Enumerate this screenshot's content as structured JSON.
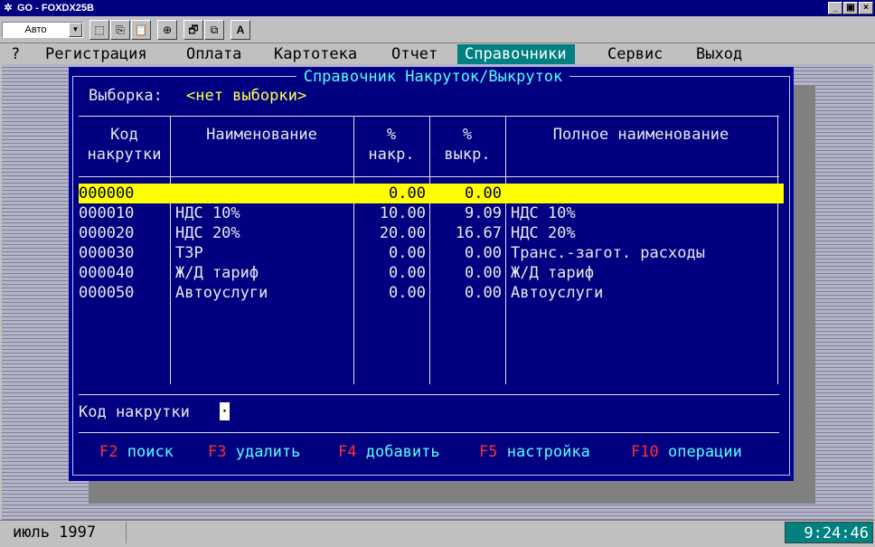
{
  "window": {
    "title": "GO - FOXDX25B",
    "buttons": [
      "_",
      "▣",
      "×"
    ]
  },
  "toolbar": {
    "combo_value": "Авто",
    "buttons": [
      "⬚",
      "⎘",
      "📋",
      "⊕",
      "🗗",
      "⧉",
      "A"
    ]
  },
  "menu": {
    "items": [
      {
        "label": "?"
      },
      {
        "label": "Регистрация"
      },
      {
        "label": "Оплата"
      },
      {
        "label": "Картотека"
      },
      {
        "label": "Отчет"
      },
      {
        "label": "Справочники"
      },
      {
        "label": "Сервис"
      },
      {
        "label": "Выход"
      }
    ]
  },
  "dialog": {
    "title": "Справочник Накруток/Выкруток",
    "filter_label": "Выборка:",
    "filter_value": "<нет выборки>",
    "columns": {
      "code_1": "Код",
      "code_2": "накрутки",
      "name": "Наименование",
      "markup_1": "%",
      "markup_2": "накр.",
      "markdown_1": "%",
      "markdown_2": "выкр.",
      "fullname": "Полное наименование"
    },
    "rows": [
      {
        "code": "000000",
        "name": "",
        "markup": "0.00",
        "markdown": "0.00",
        "fullname": ""
      },
      {
        "code": "000010",
        "name": "НДС 10%",
        "markup": "10.00",
        "markdown": "9.09",
        "fullname": "НДС 10%"
      },
      {
        "code": "000020",
        "name": "НДС 20%",
        "markup": "20.00",
        "markdown": "16.67",
        "fullname": "НДС 20%"
      },
      {
        "code": "000030",
        "name": "ТЗР",
        "markup": "0.00",
        "markdown": "0.00",
        "fullname": "Транс.-загот. расходы"
      },
      {
        "code": "000040",
        "name": "Ж/Д тариф",
        "markup": "0.00",
        "markdown": "0.00",
        "fullname": "Ж/Д тариф"
      },
      {
        "code": "000050",
        "name": "Автоуслуги",
        "markup": "0.00",
        "markdown": "0.00",
        "fullname": "Автоуслуги"
      }
    ],
    "input_label": "Код накрутки",
    "input_value": "·",
    "hotkeys": [
      {
        "key": "F2",
        "label": "поиск"
      },
      {
        "key": "F3",
        "label": "удалить"
      },
      {
        "key": "F4",
        "label": "добавить"
      },
      {
        "key": "F5",
        "label": "настройка"
      },
      {
        "key": "F10",
        "label": "операции"
      }
    ]
  },
  "status": {
    "date": "июль 1997",
    "time": "9:24:46"
  }
}
